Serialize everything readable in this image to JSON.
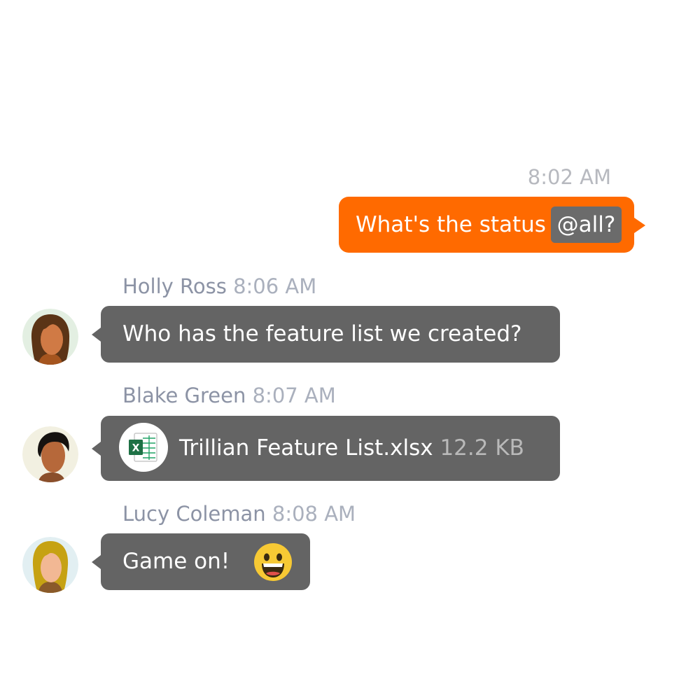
{
  "outgoing": {
    "time": "8:02 AM",
    "text": "What's the status",
    "mention": "@all?",
    "bubble_color": "#ff6a00"
  },
  "messages": [
    {
      "sender": "Holly Ross",
      "time": "8:06 AM",
      "text": "Who has the feature list we created?",
      "avatar_icon": "holly-avatar"
    },
    {
      "sender": "Blake Green",
      "time": "8:07 AM",
      "file_name": "Trillian Feature List.xlsx",
      "file_size": "12.2 KB",
      "file_icon": "excel-file-icon",
      "avatar_icon": "blake-avatar"
    },
    {
      "sender": "Lucy Coleman",
      "time": "8:08 AM",
      "text": "Game on!",
      "emoji_icon": "grinning-face-icon",
      "avatar_icon": "lucy-avatar"
    }
  ],
  "colors": {
    "incoming_bubble": "#646464",
    "sender_name": "#8c93a5",
    "timestamp": "#b7b9bf"
  }
}
